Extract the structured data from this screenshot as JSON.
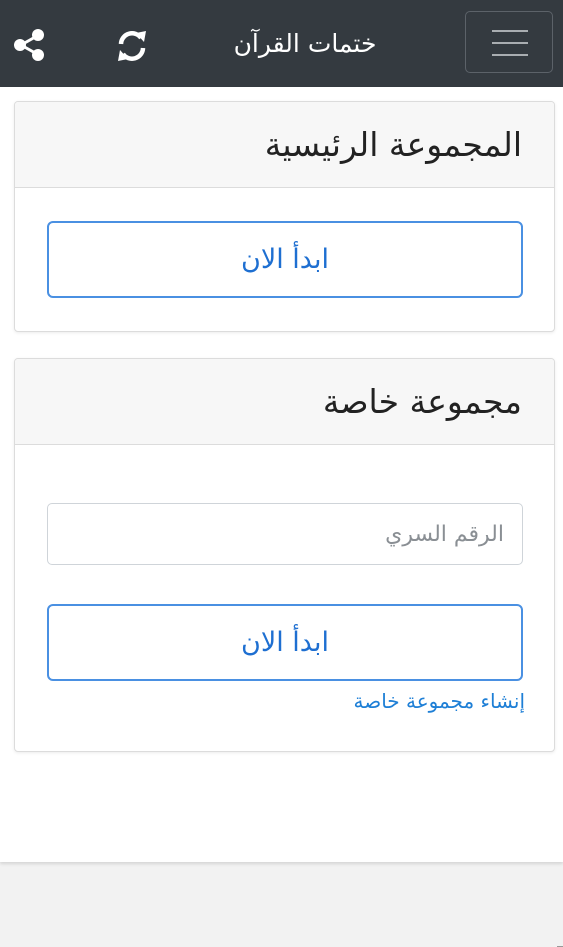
{
  "navbar": {
    "title": "ختمات القرآن",
    "share_icon": "share-icon",
    "refresh_icon": "refresh-icon",
    "menu_icon": "hamburger-menu-icon"
  },
  "main_group": {
    "title": "المجموعة الرئيسية",
    "start_label": "ابدأ الان"
  },
  "private_group": {
    "title": "مجموعة خاصة",
    "secret_placeholder": "الرقم السري",
    "secret_value": "",
    "start_label": "ابدأ الان",
    "create_link": "إنشاء مجموعة خاصة"
  },
  "colors": {
    "navbar_bg": "#343a40",
    "accent": "#4a90e2",
    "link": "#1e7fd6",
    "page_bg": "#f2f2f2"
  }
}
